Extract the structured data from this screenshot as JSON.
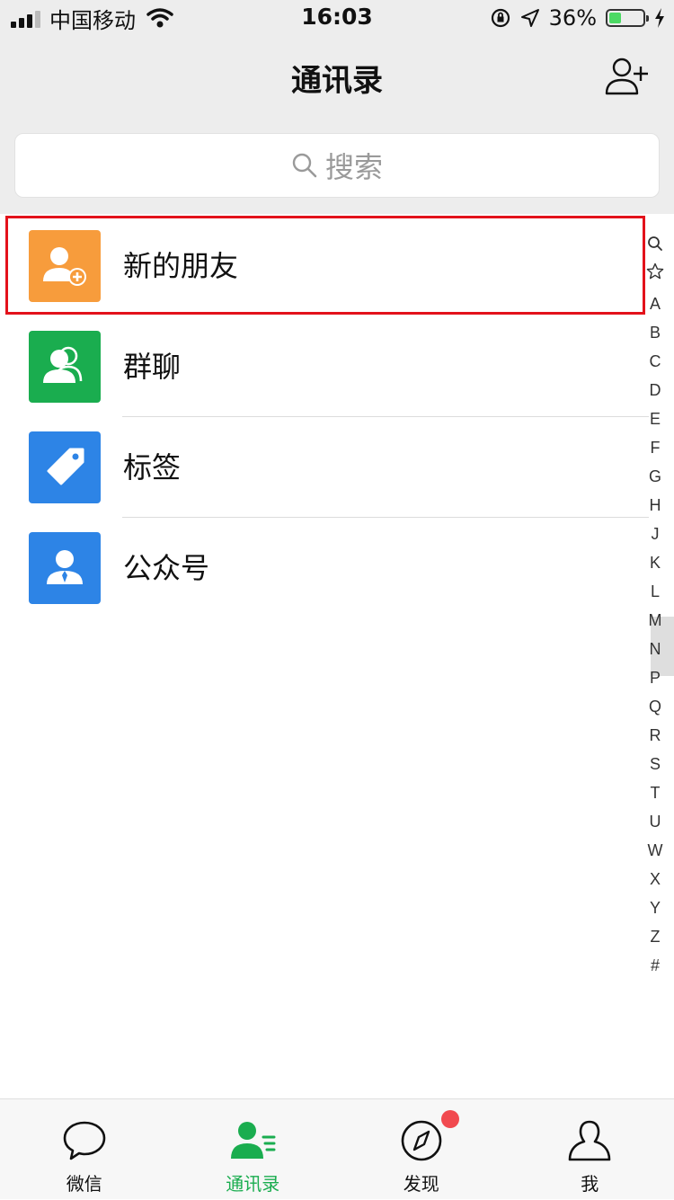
{
  "status_bar": {
    "carrier": "中国移动",
    "time": "16:03",
    "battery": "36%",
    "battery_level": 0.36
  },
  "nav": {
    "title": "通讯录",
    "add_contact_icon": "add-contact-icon"
  },
  "search": {
    "placeholder": "搜索"
  },
  "list": {
    "items": [
      {
        "label": "新的朋友",
        "icon": "new-friend-icon",
        "color": "#f79c3c"
      },
      {
        "label": "群聊",
        "icon": "group-chat-icon",
        "color": "#1aad4f"
      },
      {
        "label": "标签",
        "icon": "tag-icon",
        "color": "#2d84e6"
      },
      {
        "label": "公众号",
        "icon": "official-account-icon",
        "color": "#2d84e6"
      }
    ]
  },
  "index_bar": [
    "A",
    "B",
    "C",
    "D",
    "E",
    "F",
    "G",
    "H",
    "J",
    "K",
    "L",
    "M",
    "N",
    "P",
    "Q",
    "R",
    "S",
    "T",
    "U",
    "W",
    "X",
    "Y",
    "Z",
    "#"
  ],
  "tabs": [
    {
      "label": "微信",
      "icon": "chat-bubble-icon",
      "active": false
    },
    {
      "label": "通讯录",
      "icon": "contacts-icon",
      "active": true
    },
    {
      "label": "发现",
      "icon": "compass-icon",
      "active": false,
      "badge": true
    },
    {
      "label": "我",
      "icon": "person-icon",
      "active": false
    }
  ],
  "colors": {
    "accent": "#1aad4f",
    "highlight_box": "#e3121b",
    "badge": "#f1494f"
  }
}
